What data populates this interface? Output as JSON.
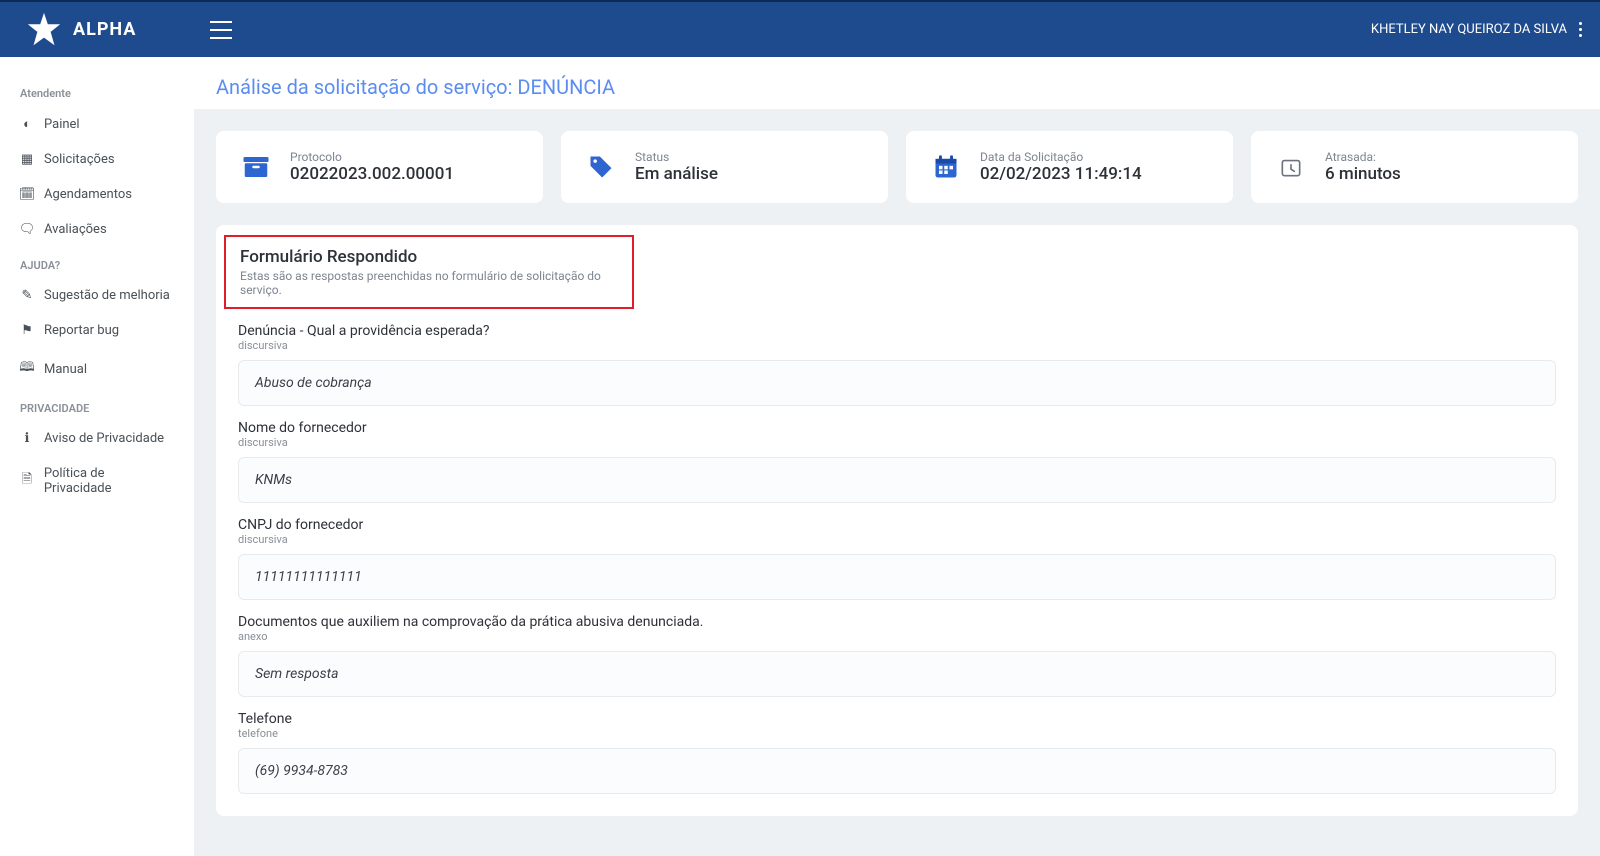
{
  "brand": {
    "name": "ALPHA"
  },
  "user": {
    "name": "KHETLEY NAY QUEIROZ DA SILVA"
  },
  "sidebar": {
    "section_atendente": "Atendente",
    "items_atendente": [
      {
        "label": "Painel"
      },
      {
        "label": "Solicitações"
      },
      {
        "label": "Agendamentos"
      },
      {
        "label": "Avaliações"
      }
    ],
    "section_ajuda": "AJUDA?",
    "items_ajuda": [
      {
        "label": "Sugestão de melhoria"
      },
      {
        "label": "Reportar bug"
      },
      {
        "label": "Manual"
      }
    ],
    "section_priv": "PRIVACIDADE",
    "items_priv": [
      {
        "label": "Aviso de Privacidade"
      },
      {
        "label": "Política de Privacidade"
      }
    ]
  },
  "page": {
    "title": "Análise da solicitação do serviço: DENÚNCIA"
  },
  "cards": {
    "protocolo": {
      "label": "Protocolo",
      "value": "02022023.002.00001"
    },
    "status": {
      "label": "Status",
      "value": "Em análise"
    },
    "data": {
      "label": "Data da Solicitação",
      "value": "02/02/2023 11:49:14"
    },
    "atrasada": {
      "label": "Atrasada:",
      "value": "6 minutos"
    }
  },
  "form": {
    "title": "Formulário Respondido",
    "subtitle": "Estas são as respostas preenchidas no formulário de solicitação do serviço.",
    "questions": [
      {
        "label": "Denúncia - Qual a providência esperada?",
        "type": "discursiva",
        "answer": "Abuso de cobrança"
      },
      {
        "label": "Nome do fornecedor",
        "type": "discursiva",
        "answer": "KNMs"
      },
      {
        "label": "CNPJ do fornecedor",
        "type": "discursiva",
        "answer": "11111111111111"
      },
      {
        "label": "Documentos que auxiliem na comprovação da prática abusiva denunciada.",
        "type": "anexo",
        "answer": "Sem resposta"
      },
      {
        "label": "Telefone",
        "type": "telefone",
        "answer": "(69) 9934-8783"
      }
    ]
  }
}
